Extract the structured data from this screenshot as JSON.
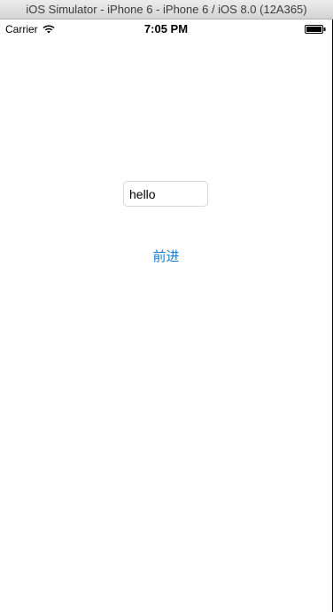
{
  "window": {
    "title": "iOS Simulator - iPhone 6 - iPhone 6 / iOS 8.0 (12A365)"
  },
  "status_bar": {
    "carrier": "Carrier",
    "time": "7:05 PM",
    "wifi_icon": "wifi-icon",
    "battery_icon": "battery-full-icon"
  },
  "main": {
    "text_field_value": "hello",
    "forward_button_label": "前进",
    "accent_color": "#1a7fd4"
  }
}
